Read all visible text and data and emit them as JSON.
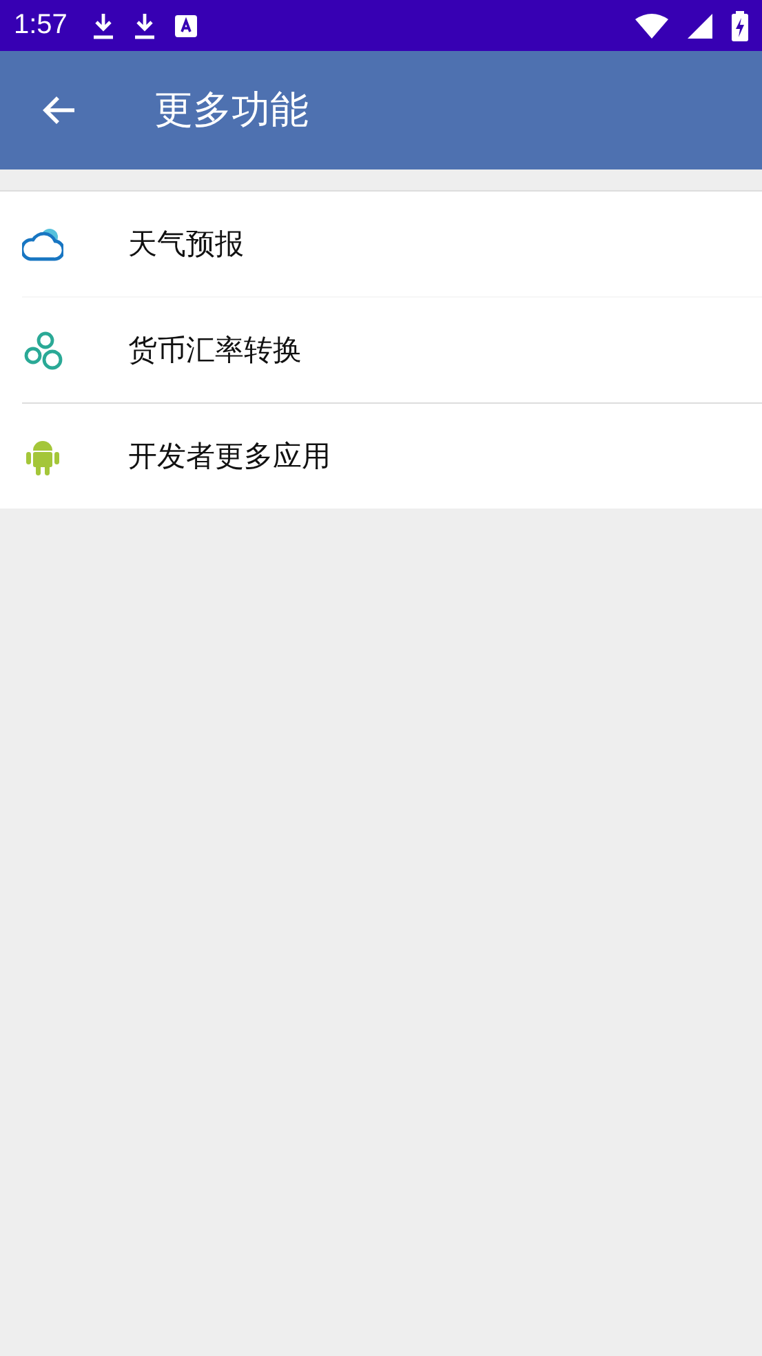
{
  "status_bar": {
    "time": "1:57"
  },
  "app_bar": {
    "title": "更多功能"
  },
  "items": [
    {
      "label": "天气预报",
      "kind": "weather"
    },
    {
      "label": "货币汇率转换",
      "kind": "currency"
    },
    {
      "label": "开发者更多应用",
      "kind": "android"
    }
  ]
}
